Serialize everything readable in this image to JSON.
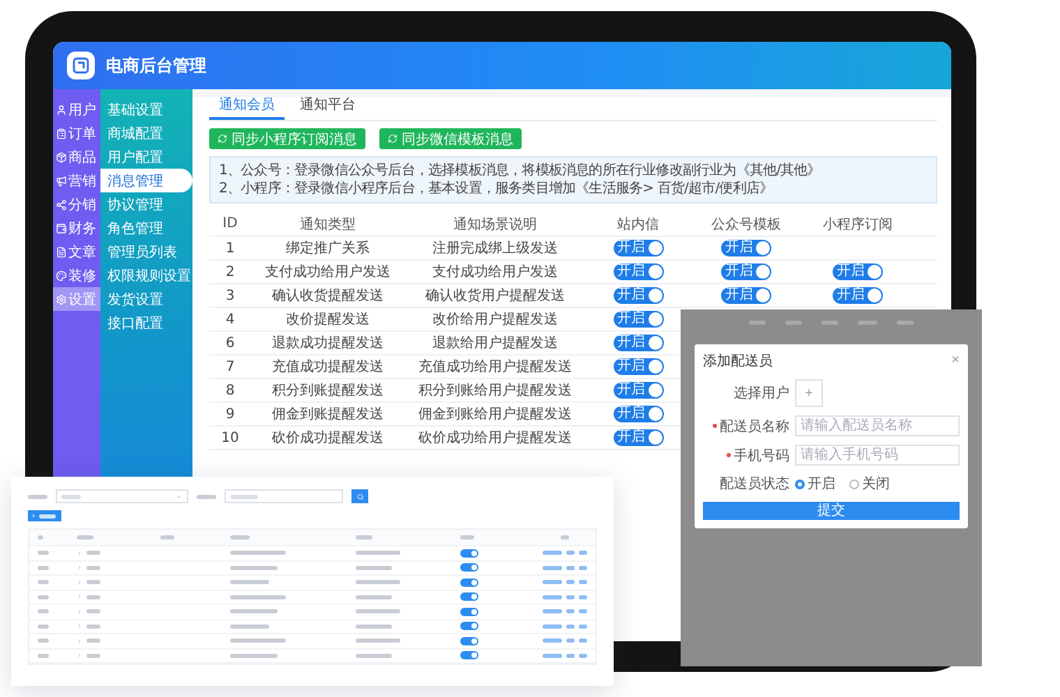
{
  "header": {
    "title": "电商后台管理"
  },
  "main_nav": [
    {
      "label": "用户",
      "selected": false
    },
    {
      "label": "订单",
      "selected": false
    },
    {
      "label": "商品",
      "selected": false
    },
    {
      "label": "营销",
      "selected": false
    },
    {
      "label": "分销",
      "selected": false
    },
    {
      "label": "财务",
      "selected": false
    },
    {
      "label": "文章",
      "selected": false
    },
    {
      "label": "装修",
      "selected": false
    },
    {
      "label": "设置",
      "selected": true
    }
  ],
  "sub_nav": [
    {
      "label": "基础设置",
      "selected": false
    },
    {
      "label": "商城配置",
      "selected": false
    },
    {
      "label": "用户配置",
      "selected": false
    },
    {
      "label": "消息管理",
      "selected": true
    },
    {
      "label": "协议管理",
      "selected": false
    },
    {
      "label": "角色管理",
      "selected": false
    },
    {
      "label": "管理员列表",
      "selected": false
    },
    {
      "label": "权限规则设置",
      "selected": false
    },
    {
      "label": "发货设置",
      "selected": false
    },
    {
      "label": "接口配置",
      "selected": false
    }
  ],
  "tabs": [
    {
      "label": "通知会员",
      "selected": true
    },
    {
      "label": "通知平台",
      "selected": false
    }
  ],
  "sync_buttons": [
    "同步小程序订阅消息",
    "同步微信模板消息"
  ],
  "notes": [
    "1、公众号：登录微信公众号后台，选择模板消息，将模板消息的所在行业修改副行业为《其他/其他》",
    "2、小程序：登录微信小程序后台，基本设置，服务类目增加《生活服务> 百货/超市/便利店》"
  ],
  "table": {
    "columns": [
      "ID",
      "通知类型",
      "通知场景说明",
      "站内信",
      "公众号模板",
      "小程序订阅"
    ],
    "rows": [
      {
        "id": "1",
        "type": "绑定推广关系",
        "scene": "注册完成绑上级发送",
        "site": {
          "label": "开启",
          "on": true
        },
        "official": {
          "label": "开启",
          "on": true
        }
      },
      {
        "id": "2",
        "type": "支付成功给用户发送",
        "scene": "支付成功给用户发送",
        "site": {
          "label": "开启",
          "on": true
        },
        "official": {
          "label": "开启",
          "on": true
        },
        "mini": {
          "label": "开启",
          "on": true
        }
      },
      {
        "id": "3",
        "type": "确认收货提醒发送",
        "scene": "确认收货用户提醒发送",
        "site": {
          "label": "开启",
          "on": true
        },
        "official": {
          "label": "开启",
          "on": true
        },
        "mini": {
          "label": "开启",
          "on": true
        }
      },
      {
        "id": "4",
        "type": "改价提醒发送",
        "scene": "改价给用户提醒发送",
        "site": {
          "label": "开启",
          "on": true
        }
      },
      {
        "id": "6",
        "type": "退款成功提醒发送",
        "scene": "退款给用户提醒发送",
        "site": {
          "label": "开启",
          "on": true
        }
      },
      {
        "id": "7",
        "type": "充值成功提醒发送",
        "scene": "充值成功给用户提醒发送",
        "site": {
          "label": "开启",
          "on": true
        }
      },
      {
        "id": "8",
        "type": "积分到账提醒发送",
        "scene": "积分到账给用户提醒发送",
        "site": {
          "label": "开启",
          "on": true
        }
      },
      {
        "id": "9",
        "type": "佣金到账提醒发送",
        "scene": "佣金到账给用户提醒发送",
        "site": {
          "label": "开启",
          "on": true
        }
      },
      {
        "id": "10",
        "type": "砍价成功提醒发送",
        "scene": "砍价成功给用户提醒发送",
        "site": {
          "label": "开启",
          "on": true
        }
      }
    ]
  },
  "list_panel": {
    "rows": [
      {
        "on": true
      },
      {
        "on": true
      },
      {
        "on": true
      },
      {
        "on": true
      },
      {
        "on": true
      },
      {
        "on": true
      },
      {
        "on": true
      },
      {
        "on": true
      }
    ]
  },
  "dialog": {
    "title": "添加配送员",
    "close": "×",
    "fields": [
      {
        "kind": "upload",
        "label": "选择用户",
        "symbol": "+"
      },
      {
        "kind": "input",
        "label": "配送员名称",
        "placeholder": "请输入配送员名称",
        "required": true
      },
      {
        "kind": "input",
        "label": "手机号码",
        "placeholder": "请输入手机号码",
        "required": true
      },
      {
        "kind": "radio",
        "label": "配送员状态",
        "options": [
          {
            "label": "开启",
            "selected": true
          },
          {
            "label": "关闭",
            "selected": false
          }
        ]
      }
    ],
    "submit": "提交"
  }
}
